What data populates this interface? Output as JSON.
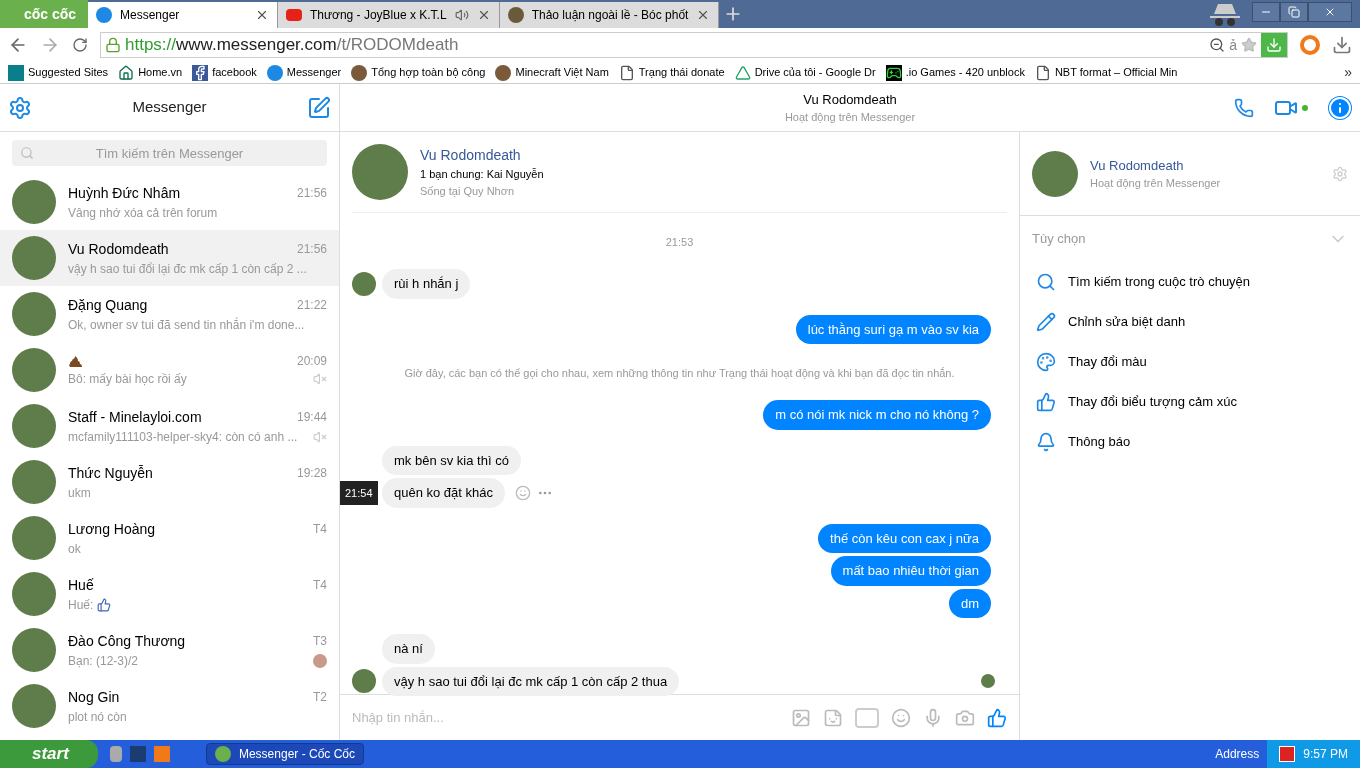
{
  "browser": {
    "brand": "cốc cốc",
    "tabs": [
      {
        "title": "Messenger",
        "selected": true,
        "kind": "messenger",
        "audio": false
      },
      {
        "title": "Thương - JoyBlue x K.T.L",
        "selected": false,
        "kind": "video",
        "audio": true
      },
      {
        "title": "Thảo luận ngoài lề - Bóc phốt",
        "selected": false,
        "kind": "avatar",
        "audio": false
      }
    ],
    "url": {
      "scheme": "https://",
      "host": "www.messenger.com",
      "path": "/t/RODOMdeath"
    },
    "typing_button": "ả",
    "bookmarks": [
      {
        "label": "Suggested Sites",
        "kind": "bing"
      },
      {
        "label": "Home.vn",
        "kind": "home"
      },
      {
        "label": "facebook",
        "kind": "facebook"
      },
      {
        "label": "Messenger",
        "kind": "messenger"
      },
      {
        "label": "Tổng hợp toàn bộ công",
        "kind": "avatar"
      },
      {
        "label": "Minecraft Việt Nam",
        "kind": "avatar"
      },
      {
        "label": "Trạng thái donate",
        "kind": "page"
      },
      {
        "label": "Drive của tôi - Google Dr",
        "kind": "drive"
      },
      {
        "label": ".io Games - 420 unblock",
        "kind": "game"
      },
      {
        "label": "NBT format – Official Min",
        "kind": "page"
      }
    ],
    "more": "»"
  },
  "sidebar": {
    "title": "Messenger",
    "search": {
      "placeholder": "Tìm kiếm trên Messenger"
    },
    "conversations": [
      {
        "kind": "text",
        "name": "Huỳnh Đức Nhâm",
        "preview": "Vâng nhớ xóa cả trên forum",
        "time": "21:56",
        "selected": false,
        "muted": false
      },
      {
        "kind": "text",
        "name": "Vu Rodomdeath",
        "preview": "vậy h sao tui đổi lại đc mk cấp 1 còn cấp 2 ...",
        "time": "21:56",
        "selected": true,
        "muted": false
      },
      {
        "kind": "text",
        "name": "Đặng Quang",
        "preview": "Ok, owner sv tui đã send tin nhắn i'm done...",
        "time": "21:22",
        "selected": false,
        "muted": false
      },
      {
        "kind": "emoji",
        "preview": "Bô: mấy bài học rồi ấy",
        "time": "20:09",
        "selected": false,
        "muted": true
      },
      {
        "kind": "text",
        "name": "Staff - Minelayloi.com",
        "preview": "mcfamily111103-helper-sky4: còn có anh ...",
        "time": "19:44",
        "selected": false,
        "muted": true
      },
      {
        "kind": "text",
        "name": "Thức Nguyễn",
        "preview": "ukm",
        "time": "19:28",
        "selected": false,
        "muted": false
      },
      {
        "kind": "text",
        "name": "Lương Hoàng",
        "preview": "ok",
        "time": "T4",
        "selected": false,
        "muted": false
      },
      {
        "kind": "text",
        "name": "Huế",
        "preview": "Huế:",
        "like": true,
        "time": "T4",
        "selected": false,
        "muted": false
      },
      {
        "kind": "text",
        "name": "Đào Công Thương",
        "preview": "Bạn: (12-3)/2",
        "time": "T3",
        "selected": false,
        "muted": false,
        "seen": true
      },
      {
        "kind": "text",
        "name": "Nog Gin",
        "preview": "plot nó còn",
        "time": "T2",
        "selected": false,
        "muted": false
      }
    ]
  },
  "chat": {
    "name": "Vu Rodomdeath",
    "status": "Hoạt động trên Messenger",
    "profile": {
      "name": "Vu Rodomdeath",
      "mutual": "1 bạn chung: Kai Nguyễn",
      "location": "Sống tại Quy Nhơn"
    },
    "messages": [
      {
        "kind": "time",
        "text": "21:53"
      },
      {
        "kind": "in",
        "text": "rùi h nhắn j",
        "avatar": true
      },
      {
        "kind": "out",
        "text": "lúc thằng suri gạ m vào sv kia"
      },
      {
        "kind": "notice",
        "text": "Giờ đây, các bạn có thể gọi cho nhau, xem những thông tin như Trạng thái hoạt động và khi bạn đã đọc tin nhắn."
      },
      {
        "kind": "out",
        "text": "m có nói mk nick m cho nó không ?"
      },
      {
        "kind": "in",
        "text": "mk bên sv kia thì có"
      },
      {
        "kind": "in",
        "text": "quên ko đặt khác",
        "hover_time": "21:54"
      },
      {
        "kind": "out",
        "text": "thế còn kêu con cax j nữa"
      },
      {
        "kind": "out",
        "text": "mất bao nhiêu thời gian"
      },
      {
        "kind": "out",
        "text": "dm"
      },
      {
        "kind": "in",
        "text": "nà ní"
      },
      {
        "kind": "in",
        "text": "vậy h sao tui đổi lại đc mk cấp 1 còn cấp 2 thua",
        "avatar": true,
        "seen": true
      }
    ],
    "composer": {
      "placeholder": "Nhập tin nhắn..."
    }
  },
  "details": {
    "name": "Vu Rodomdeath",
    "status": "Hoạt động trên Messenger",
    "options_title": "Tùy chọn",
    "expanded": true,
    "options": [
      {
        "label": "Tìm kiếm trong cuộc trò chuyện",
        "kind": "search"
      },
      {
        "label": "Chỉnh sửa biệt danh",
        "kind": "nickname"
      },
      {
        "label": "Thay đổi màu",
        "kind": "color"
      },
      {
        "label": "Thay đổi biểu tượng cảm xúc",
        "kind": "emoji"
      },
      {
        "label": "Thông báo",
        "kind": "notify"
      }
    ]
  },
  "taskbar": {
    "start": "start",
    "window": "Messenger - Cốc Cốc",
    "address": "Address",
    "clock": "9:57 PM"
  }
}
